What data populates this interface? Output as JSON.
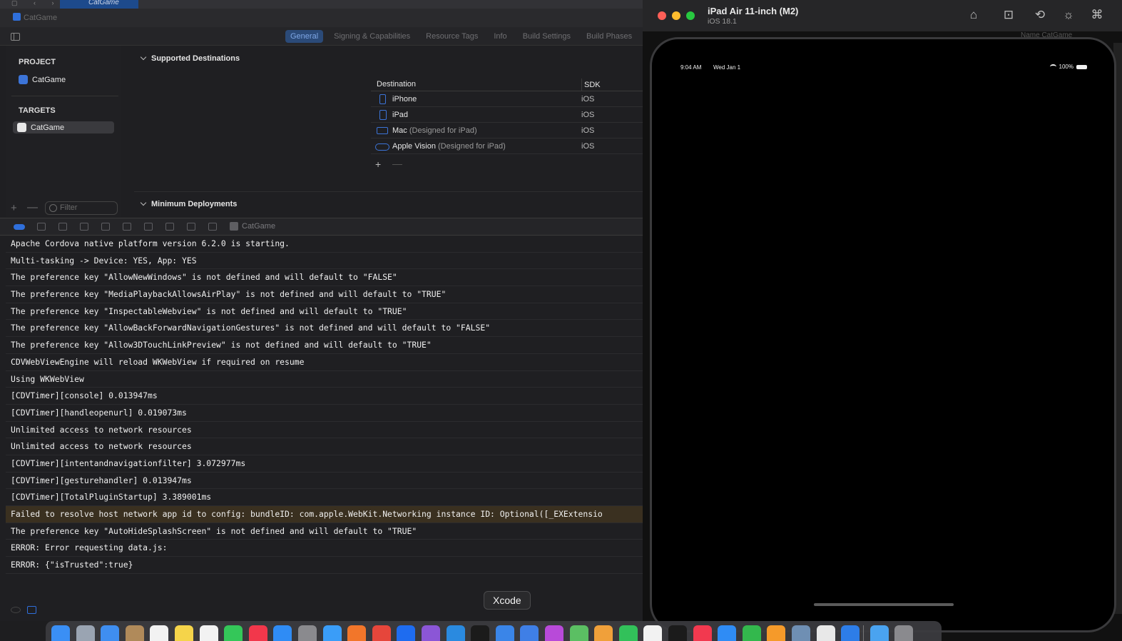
{
  "xcode": {
    "tab_title": "CatGame",
    "breadcrumb": "CatGame",
    "tabs": [
      {
        "label": "General"
      },
      {
        "label": "Signing & Capabilities"
      },
      {
        "label": "Resource Tags"
      },
      {
        "label": "Info"
      },
      {
        "label": "Build Settings"
      },
      {
        "label": "Build Phases"
      }
    ],
    "sidebar": {
      "project_header": "PROJECT",
      "project_item": "CatGame",
      "targets_header": "TARGETS",
      "target_item": "CatGame",
      "filter_placeholder": "Filter"
    },
    "editor": {
      "supported_destinations": "Supported Destinations",
      "minimum_deployments": "Minimum Deployments",
      "table_headers": {
        "destination": "Destination",
        "sdk": "SDK"
      },
      "destinations": [
        {
          "name": "iPhone",
          "sub": "",
          "sdk": "iOS",
          "icon": "iphone-icon"
        },
        {
          "name": "iPad",
          "sub": "",
          "sdk": "iOS",
          "icon": "ipad-icon"
        },
        {
          "name": "Mac",
          "sub": "(Designed for iPad)",
          "sdk": "iOS",
          "icon": "mac-icon"
        },
        {
          "name": "Apple Vision",
          "sub": "(Designed for iPad)",
          "sdk": "iOS",
          "icon": "vision-icon"
        }
      ],
      "add_symbol": "+",
      "remove_symbol": "—"
    },
    "debug_bar": {
      "target": "CatGame"
    },
    "console_lines": [
      "Apache Cordova native platform version 6.2.0 is starting.",
      "Multi-tasking -> Device: YES, App: YES",
      "The preference key \"AllowNewWindows\" is not defined and will default to \"FALSE\"",
      "The preference key \"MediaPlaybackAllowsAirPlay\" is not defined and will default to \"TRUE\"",
      "The preference key \"InspectableWebview\" is not defined and will default to \"TRUE\"",
      "The preference key \"AllowBackForwardNavigationGestures\" is not defined and will default to \"FALSE\"",
      "The preference key \"Allow3DTouchLinkPreview\" is not defined and will default to \"TRUE\"",
      "CDVWebViewEngine will reload WKWebView if required on resume",
      "Using WKWebView",
      "[CDVTimer][console] 0.013947ms",
      "[CDVTimer][handleopenurl] 0.019073ms",
      "Unlimited access to network resources",
      "Unlimited access to network resources",
      "[CDVTimer][intentandnavigationfilter] 3.072977ms",
      "[CDVTimer][gesturehandler] 0.013947ms",
      "[CDVTimer][TotalPluginStartup] 3.389001ms",
      "Failed to resolve host network app id to config: bundleID: com.apple.WebKit.Networking instance ID: Optional([_EXExtensio",
      "The preference key \"AutoHideSplashScreen\" is not defined and will default to \"TRUE\"",
      "ERROR: Error requesting data.js:",
      "ERROR: {\"isTrusted\":true}"
    ],
    "warning_line_index": 16
  },
  "simulator": {
    "device_name": "iPad Air 11-inch (M2)",
    "os_version": "iOS 18.1",
    "behind_text": "Name   CatGame",
    "status_time": "9:04 AM",
    "status_date": "Wed Jan 1",
    "battery": "100%",
    "toolbar_icons": [
      "home-icon",
      "screenshot-icon",
      "rotate-icon",
      "appearance-icon",
      "command-icon"
    ]
  },
  "tooltip": "Xcode",
  "colors": {
    "accent": "#2f6fdb",
    "traffic_red": "#fe5f57",
    "traffic_yellow": "#febc2e",
    "traffic_green": "#28c840",
    "warning_bg": "#3a3020"
  },
  "dock": {
    "apps": [
      {
        "name": "finder-icon",
        "color": "#3a8ff5"
      },
      {
        "name": "launchpad-icon",
        "color": "#9aa4b2"
      },
      {
        "name": "mail-icon",
        "color": "#3f8ef0"
      },
      {
        "name": "contacts-icon",
        "color": "#b08a5a"
      },
      {
        "name": "calendar-icon",
        "color": "#f2f2f2"
      },
      {
        "name": "notes-icon",
        "color": "#f5d44a"
      },
      {
        "name": "reminders-icon",
        "color": "#f2f2f2"
      },
      {
        "name": "messages-icon",
        "color": "#34c759"
      },
      {
        "name": "news-icon",
        "color": "#f2374b"
      },
      {
        "name": "appstore-icon",
        "color": "#2f8cf5"
      },
      {
        "name": "system-settings-icon",
        "color": "#8a8a8e"
      },
      {
        "name": "safari-icon",
        "color": "#3a9df8"
      },
      {
        "name": "firefox-icon",
        "color": "#f2762a"
      },
      {
        "name": "chrome-icon",
        "color": "#e6463b"
      },
      {
        "name": "dropbox-icon",
        "color": "#1e6cf0"
      },
      {
        "name": "visual-studio-icon",
        "color": "#8b56d6"
      },
      {
        "name": "vscode-icon",
        "color": "#2a8ae0"
      },
      {
        "name": "terminal-icon",
        "color": "#1b1b1b"
      },
      {
        "name": "xcode-icon",
        "color": "#3a85e8"
      },
      {
        "name": "instruments-icon",
        "color": "#3f7fe6"
      },
      {
        "name": "affinity-icon",
        "color": "#b84ad9"
      },
      {
        "name": "maps-icon",
        "color": "#5bbf63"
      },
      {
        "name": "photos-icon",
        "color": "#f0a03a"
      },
      {
        "name": "facetime-icon",
        "color": "#32c15a"
      },
      {
        "name": "freeform-icon",
        "color": "#f2f2f2"
      },
      {
        "name": "appletv-icon",
        "color": "#1b1b1b"
      },
      {
        "name": "music-icon",
        "color": "#f2394f"
      },
      {
        "name": "keynote-icon",
        "color": "#2f8cf5"
      },
      {
        "name": "numbers-icon",
        "color": "#33b84d"
      },
      {
        "name": "pages-icon",
        "color": "#f59a2a"
      },
      {
        "name": "preview-icon",
        "color": "#6f8fb3"
      },
      {
        "name": "textedit-icon",
        "color": "#e8e8e8"
      },
      {
        "name": "simulator-icon",
        "color": "#2d7de8"
      },
      {
        "name": "downloads-folder-icon",
        "color": "#4aa3f0"
      },
      {
        "name": "trash-icon",
        "color": "#8a8a8e"
      }
    ]
  }
}
